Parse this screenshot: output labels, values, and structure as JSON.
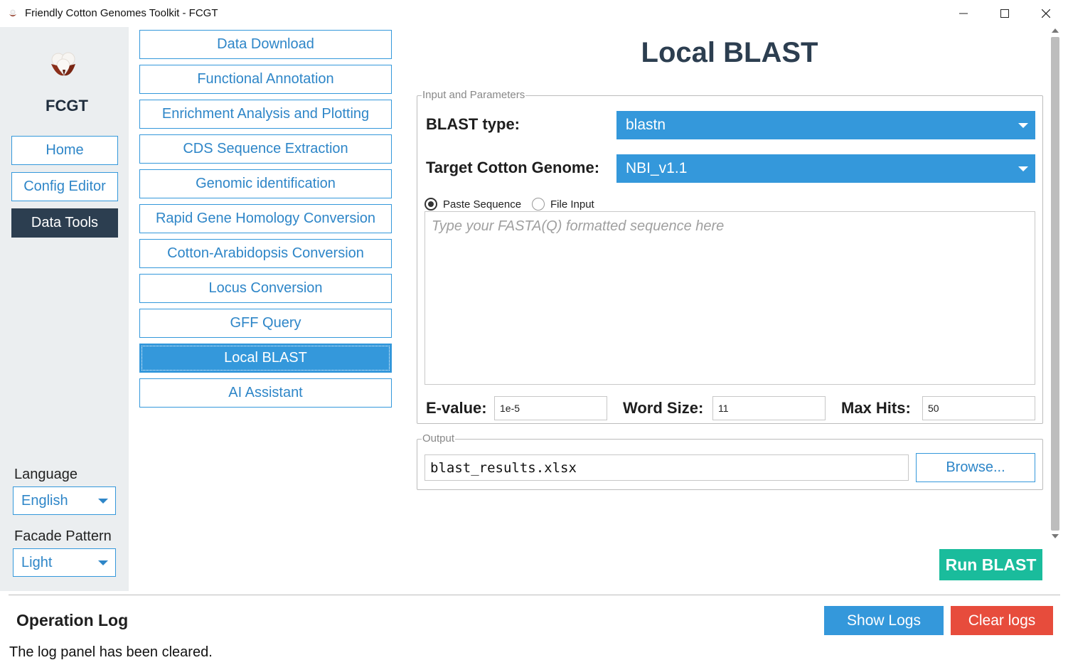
{
  "window": {
    "title": "Friendly Cotton Genomes Toolkit - FCGT",
    "minimize_glyph": "—",
    "maximize_glyph": "☐",
    "close_glyph": "✕"
  },
  "sidebar": {
    "brand": "FCGT",
    "nav": [
      {
        "label": "Home",
        "icon": "none"
      },
      {
        "label": "Config Editor",
        "icon": "none"
      },
      {
        "label": "Data Tools",
        "icon": "none"
      }
    ],
    "language_label": "Language",
    "language_value": "English",
    "facade_label": "Facade Pattern",
    "facade_value": "Light"
  },
  "tools": [
    "Data Download",
    "Functional Annotation",
    "Enrichment Analysis and Plotting",
    "CDS Sequence Extraction",
    "Genomic identification",
    "Rapid Gene Homology Conversion",
    "Cotton-Arabidopsis Conversion",
    "Locus Conversion",
    "GFF Query",
    "Local BLAST",
    "AI Assistant"
  ],
  "main": {
    "title": "Local BLAST",
    "input_group_title": "Input and Parameters",
    "blast_type_label": "BLAST type:",
    "blast_type_value": "blastn",
    "genome_label": "Target Cotton Genome:",
    "genome_value": "NBI_v1.1",
    "radio_paste": "Paste Sequence",
    "radio_file": "File Input",
    "sequence_placeholder": "Type your FASTA(Q) formatted sequence here",
    "evalue_label": "E-value:",
    "evalue_value": "1e-5",
    "wordsize_label": "Word Size:",
    "wordsize_value": "11",
    "maxhits_label": "Max Hits:",
    "maxhits_value": "50",
    "output_group_title": "Output",
    "output_value": "blast_results.xlsx",
    "browse_label": "Browse...",
    "run_label": "Run BLAST"
  },
  "log": {
    "title": "Operation Log",
    "message": "The log panel has been cleared.",
    "show_label": "Show Logs",
    "clear_label": "Clear logs"
  },
  "colors": {
    "accent": "#3498db",
    "dark": "#2c3e50",
    "run": "#1abc9c",
    "danger": "#e74c3c"
  }
}
